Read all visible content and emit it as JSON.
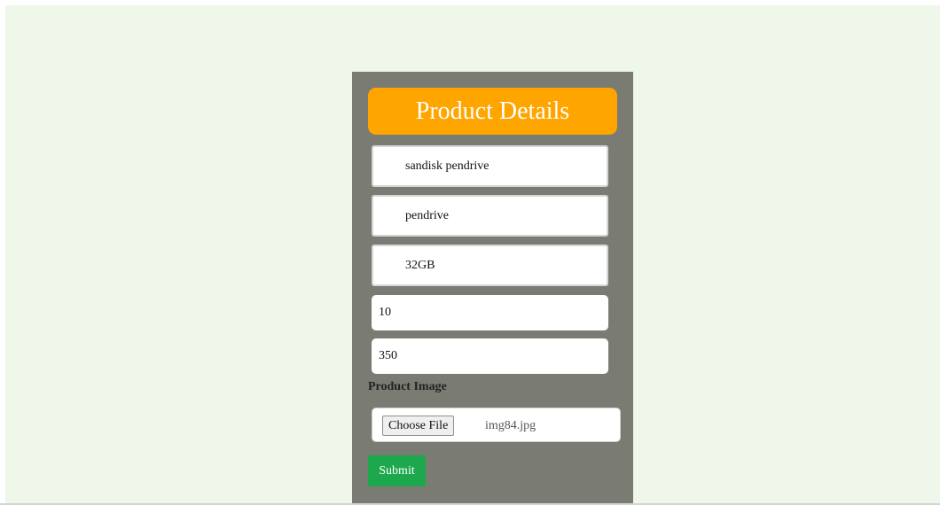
{
  "form": {
    "title": "Product Details",
    "fields": {
      "product_name": "sandisk pendrive",
      "category": "pendrive",
      "capacity": "32GB",
      "quantity": "10",
      "price": "350"
    },
    "image_label": "Product Image",
    "choose_file_label": "Choose File",
    "file_name": "img84.jpg",
    "submit_label": "Submit"
  },
  "colors": {
    "page_background": "#eef7e9",
    "panel": "#7a7b73",
    "header": "#ffa500",
    "submit": "#1ea84d"
  }
}
